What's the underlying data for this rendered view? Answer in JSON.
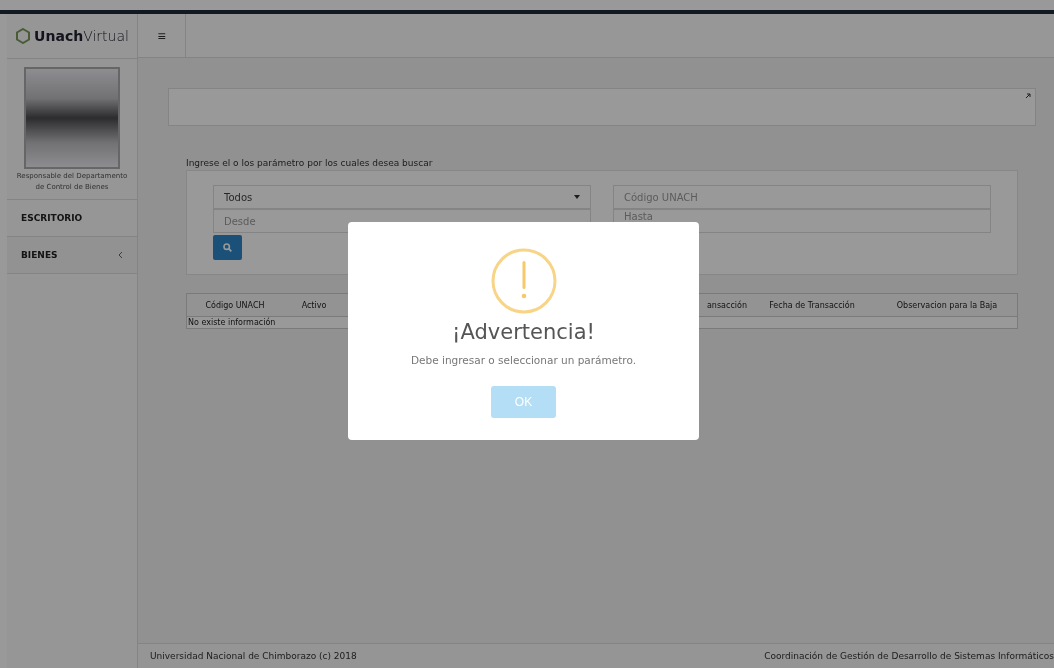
{
  "brand": {
    "bold": "Unach",
    "light": "Virtual"
  },
  "user": {
    "role": "Responsable del Departamento de Control de Bienes"
  },
  "sidebar": {
    "items": [
      {
        "label": "ESCRITORIO",
        "has_caret": false
      },
      {
        "label": "BIENES",
        "has_caret": true
      }
    ]
  },
  "toolbar": {
    "menu_icon": "≡"
  },
  "search": {
    "prompt": "Ingrese el o los parámetro por los cuales desea buscar",
    "select": {
      "value": "Todos"
    },
    "code_field": {
      "placeholder": "Código UNACH"
    },
    "from_field": {
      "placeholder": "Desde"
    },
    "to_field": {
      "placeholder": "Hasta"
    }
  },
  "table": {
    "columns": [
      {
        "label": "Código UNACH",
        "kind": "text"
      },
      {
        "label": "Activo",
        "kind": "text"
      },
      {
        "kind": "hidden"
      },
      {
        "label": "ansacción",
        "kind": "cut"
      },
      {
        "label": "Fecha de Transacción",
        "kind": "text"
      },
      {
        "label": "Observacion para la Baja",
        "kind": "text"
      }
    ],
    "empty": "No existe información"
  },
  "footer": {
    "left": "Universidad Nacional de Chimborazo (c) 2018",
    "right": "Coordinación de Gestión de Desarrollo de Sistemas Informáticos"
  },
  "dialog": {
    "title": "¡Advertencia!",
    "message": "Debe ingresar o seleccionar un parámetro.",
    "button": "OK"
  }
}
